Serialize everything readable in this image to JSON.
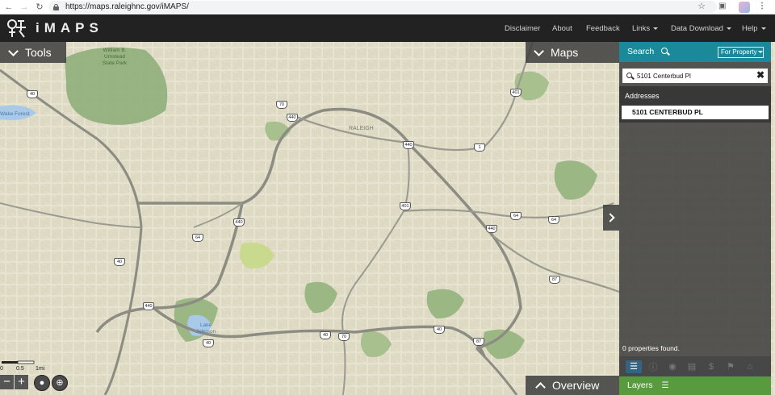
{
  "browser": {
    "url": "https://maps.raleighnc.gov/iMAPS/",
    "icons": [
      "back-icon",
      "forward-icon",
      "reload-icon",
      "lock-icon",
      "star-icon",
      "extension-icon",
      "profile-avatar",
      "kebab-menu-icon"
    ]
  },
  "header": {
    "app_name": "iMAPS",
    "menu": [
      {
        "label": "Disclaimer",
        "dropdown": false
      },
      {
        "label": "About",
        "dropdown": false
      },
      {
        "label": "Feedback",
        "dropdown": false
      },
      {
        "label": "Links",
        "dropdown": true
      },
      {
        "label": "Data Download",
        "dropdown": true
      },
      {
        "label": "Help",
        "dropdown": true
      }
    ]
  },
  "map": {
    "tools_label": "Tools",
    "maps_label": "Maps",
    "overview_label": "Overview",
    "place_labels": [
      "RALEIGH"
    ],
    "park_labels": [
      "William B. Umstead State Park"
    ],
    "water_labels": [
      "Lake Johnson",
      "Wake Forest"
    ],
    "route_shields": [
      "40",
      "70",
      "440",
      "1",
      "401",
      "540",
      "64",
      "87"
    ],
    "scale": {
      "values": [
        "0",
        "0.5",
        "1mi"
      ]
    }
  },
  "search": {
    "title": "Search",
    "type_select": "For Property",
    "input_value": "5101 Centerbud Pl",
    "results_heading": "Addresses",
    "results": [
      "5101 CENTERBUD PL"
    ],
    "count_text": "0 properties found."
  },
  "result_toolbar": {
    "icons": [
      "list-icon",
      "info-icon",
      "camera-icon",
      "document-icon",
      "dollar-icon",
      "flag-icon",
      "home-icon"
    ]
  },
  "layers": {
    "label": "Layers"
  },
  "colors": {
    "header_bg": "#222222",
    "search_accent": "#1a8a9a",
    "layers_green": "#5a9a3e",
    "map_base": "#ddd9c3",
    "park_green": "#8fae7a",
    "water": "#a9c9e8"
  }
}
